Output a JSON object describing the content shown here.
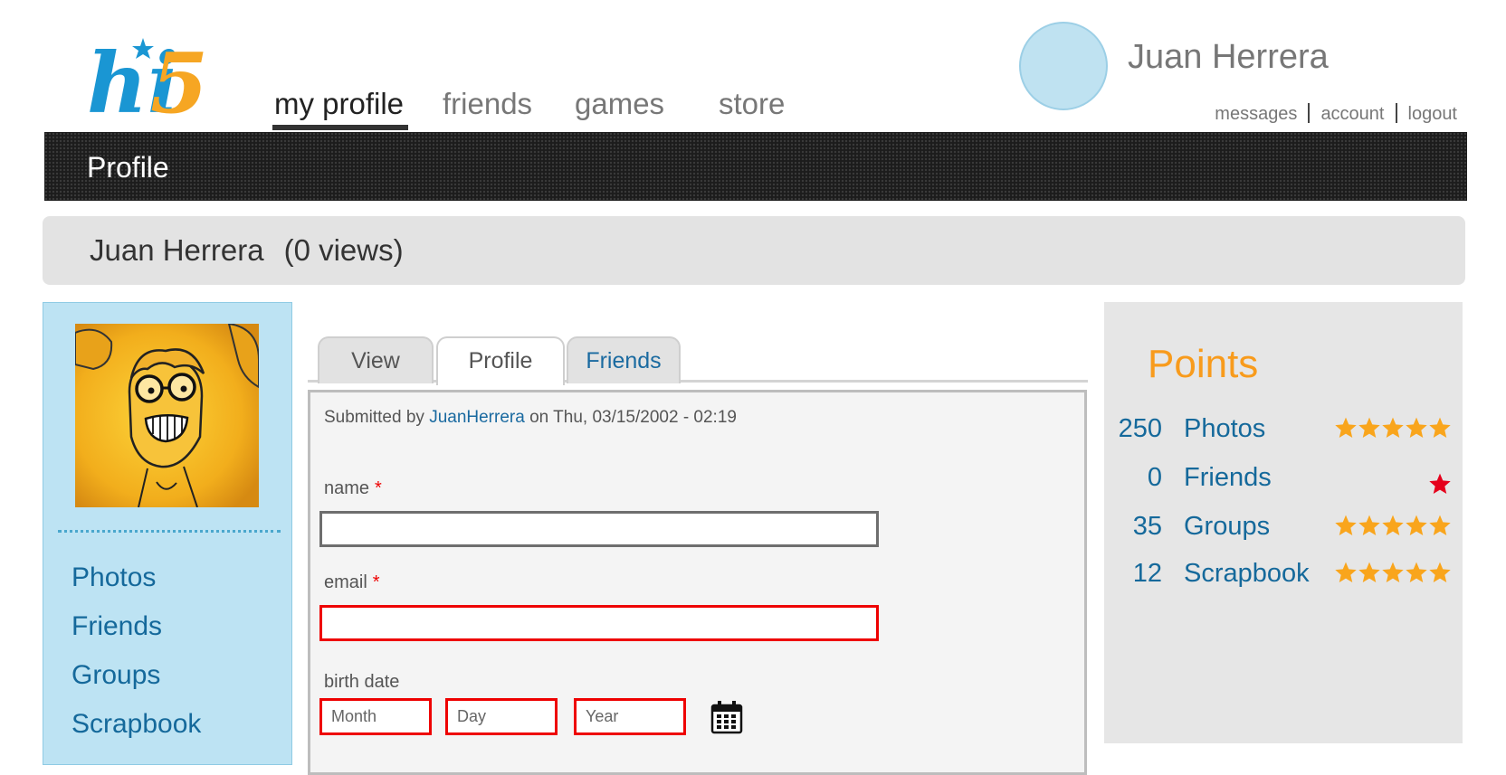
{
  "brand": {
    "logo_text": "hi5"
  },
  "nav": {
    "items": [
      {
        "label": "my profile",
        "active": true
      },
      {
        "label": "friends"
      },
      {
        "label": "games"
      },
      {
        "label": "store"
      }
    ]
  },
  "user": {
    "name": "Juan Herrera",
    "links": [
      "messages",
      "account",
      "logout"
    ]
  },
  "section": {
    "title": "Profile"
  },
  "profile": {
    "name": "Juan Herrera",
    "views": "(0 views)"
  },
  "sidebar": {
    "links": [
      "Photos",
      "Friends",
      "Groups",
      "Scrapbook"
    ]
  },
  "tabs": [
    {
      "label": "View"
    },
    {
      "label": "Profile",
      "active": true
    },
    {
      "label": "Friends"
    }
  ],
  "form": {
    "submitted_prefix": "Submitted by",
    "submitted_author": "JuanHerrera",
    "submitted_suffix": "on Thu, 03/15/2002 - 02:19",
    "name_label": "name",
    "email_label": "email",
    "required_mark": "*",
    "birth_label": "birth date",
    "month_placeholder": "Month",
    "day_placeholder": "Day",
    "year_placeholder": "Year",
    "calendar_icon": "calendar-icon"
  },
  "points": {
    "title": "Points",
    "rows": [
      {
        "value": "250",
        "label": "Photos",
        "stars": 5,
        "star_color": "#f9a51c"
      },
      {
        "value": "0",
        "label": "Friends",
        "stars": 1,
        "star_color": "#e5001c"
      },
      {
        "value": "35",
        "label": "Groups",
        "stars": 5,
        "star_color": "#f9a51c"
      },
      {
        "value": "12",
        "label": "Scrapbook",
        "stars": 5,
        "star_color": "#f9a51c"
      }
    ]
  },
  "colors": {
    "link_blue": "#15699b",
    "orange": "#f89b1c",
    "error_red": "#e00000",
    "sidebar_bg": "#bde3f3"
  }
}
